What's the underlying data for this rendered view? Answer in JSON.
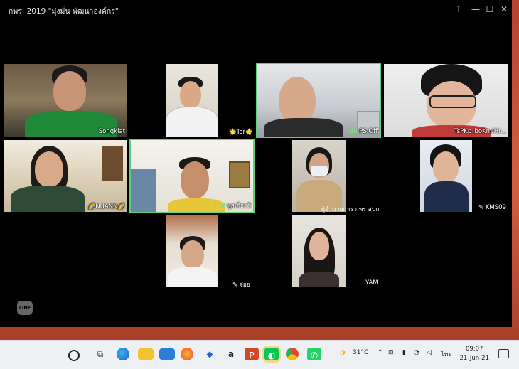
{
  "window": {
    "title": "กพร. 2019 \"มุ่งมั่น พัฒนาองค์กร\"",
    "controls": [
      "pin-icon",
      "minimize-icon",
      "maximize-icon",
      "close-icon"
    ]
  },
  "participants": [
    {
      "name": "Songkiat",
      "active": false
    },
    {
      "name": "🌟Tor🌟",
      "active": false
    },
    {
      "name": "PS.Off",
      "active": true,
      "speaking": true
    },
    {
      "name": "TsPKp_boKm/Hr...",
      "active": false
    },
    {
      "name": "🌈NUANN🌈",
      "active": false
    },
    {
      "name": "พูลเกียรติ",
      "active": true,
      "speaking": true
    },
    {
      "name": "ผู้อำนวยการ กพร สปก",
      "active": false
    },
    {
      "name": "KMS09",
      "active": false
    },
    {
      "name": "จ๋อย",
      "active": false
    },
    {
      "name": "YAM",
      "active": false
    }
  ],
  "line_logo": "LINE",
  "taskbar": {
    "weather": "31°C",
    "language": "ไทย",
    "time": "09:07",
    "date": "21-Jun-21"
  },
  "colors": {
    "active_border": "#5ad07a",
    "window_bg": "#000000"
  }
}
